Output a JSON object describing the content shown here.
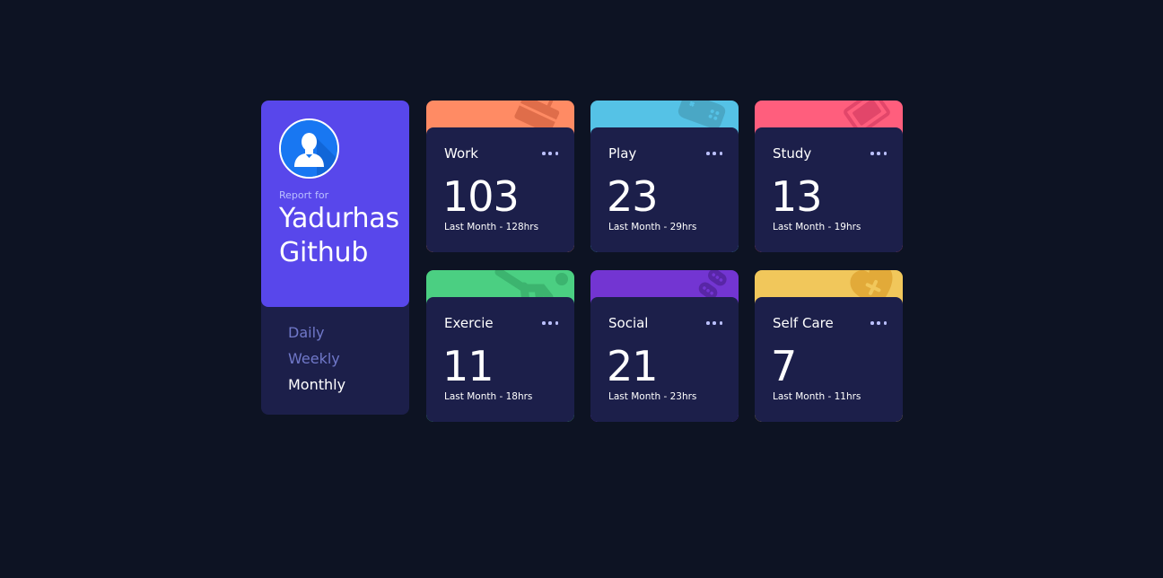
{
  "profile": {
    "report_for": "Report for",
    "name_first": "Yadurhas",
    "name_second": "Github",
    "avatar_icon": "user-avatar-icon",
    "colors": {
      "card": "#5847eb",
      "panel": "#1c1f4a"
    }
  },
  "periods": [
    {
      "label": "Daily",
      "active": false
    },
    {
      "label": "Weekly",
      "active": false
    },
    {
      "label": "Monthly",
      "active": true
    }
  ],
  "cards": [
    {
      "title": "Work",
      "value": "103",
      "previous": "Last Month - 128hrs",
      "color": "#ff8b64",
      "icon": "briefcase-icon"
    },
    {
      "title": "Play",
      "value": "23",
      "previous": "Last Month - 29hrs",
      "color": "#55c2e6",
      "icon": "gamepad-icon"
    },
    {
      "title": "Study",
      "value": "13",
      "previous": "Last Month - 19hrs",
      "color": "#ff5e7d",
      "icon": "book-icon"
    },
    {
      "title": "Exercie",
      "value": "11",
      "previous": "Last Month - 18hrs",
      "color": "#4bcf82",
      "icon": "running-icon"
    },
    {
      "title": "Social",
      "value": "21",
      "previous": "Last Month - 23hrs",
      "color": "#7335d2",
      "icon": "chat-icon"
    },
    {
      "title": "Self Care",
      "value": "7",
      "previous": "Last Month - 11hrs",
      "color": "#f1c75b",
      "icon": "heart-icon"
    }
  ],
  "menu_icon": "ellipsis-icon"
}
